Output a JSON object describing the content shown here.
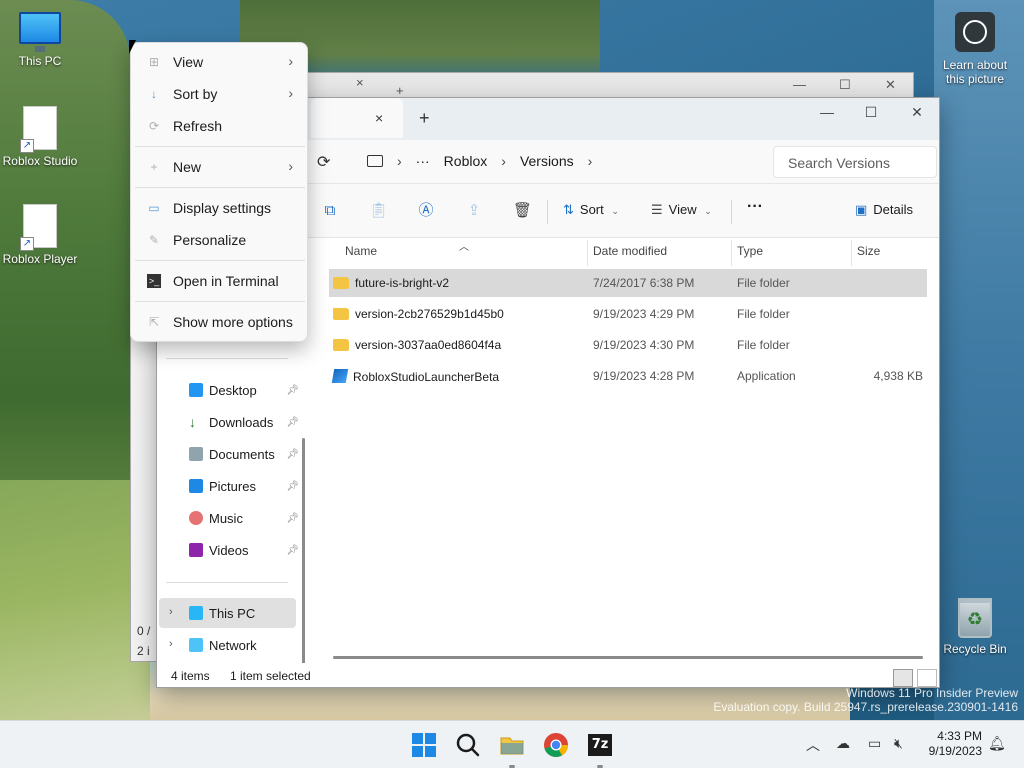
{
  "desktop": {
    "icons": [
      {
        "label": "This PC"
      },
      {
        "label": "Roblox Studio"
      },
      {
        "label": "Roblox Player"
      },
      {
        "label": "Recycle Bin"
      }
    ],
    "learn_label": "Learn about this picture"
  },
  "back_window": {
    "status_line1": "0 /",
    "status_line2": "2 i"
  },
  "explorer": {
    "tab_close": "×",
    "tab_new": "+",
    "controls": {
      "minimize": "—",
      "maximize": "☐",
      "close": "✕"
    },
    "breadcrumb": {
      "more": "···",
      "items": [
        "Roblox",
        "Versions"
      ]
    },
    "search_placeholder": "Search Versions",
    "commands": {
      "sort": "Sort",
      "view": "View",
      "more": "···",
      "details": "Details"
    },
    "nav": {
      "quick_access": [
        {
          "label": "Desktop",
          "icon": "desktop-icon",
          "color": "#2196f3"
        },
        {
          "label": "Downloads",
          "icon": "download-icon",
          "color": "#2e7d32"
        },
        {
          "label": "Documents",
          "icon": "document-icon",
          "color": "#78909c"
        },
        {
          "label": "Pictures",
          "icon": "picture-icon",
          "color": "#1e88e5"
        },
        {
          "label": "Music",
          "icon": "music-icon",
          "color": "#e57373"
        },
        {
          "label": "Videos",
          "icon": "video-icon",
          "color": "#8e24aa"
        }
      ],
      "this_pc": "This PC",
      "network": "Network"
    },
    "columns": [
      "Name",
      "Date modified",
      "Type",
      "Size"
    ],
    "files": [
      {
        "name": "future-is-bright-v2",
        "date": "7/24/2017 6:38 PM",
        "type": "File folder",
        "size": "",
        "kind": "folder",
        "selected": true
      },
      {
        "name": "version-2cb276529b1d45b0",
        "date": "9/19/2023 4:29 PM",
        "type": "File folder",
        "size": "",
        "kind": "folder",
        "selected": false
      },
      {
        "name": "version-3037aa0ed8604f4a",
        "date": "9/19/2023 4:30 PM",
        "type": "File folder",
        "size": "",
        "kind": "folder",
        "selected": false
      },
      {
        "name": "RobloxStudioLauncherBeta",
        "date": "9/19/2023 4:28 PM",
        "type": "Application",
        "size": "4,938 KB",
        "kind": "app",
        "selected": false
      }
    ],
    "status": {
      "count": "4 items",
      "selection": "1 item selected"
    }
  },
  "context_menu": {
    "items": [
      {
        "label": "View",
        "icon": "grid-icon",
        "submenu": true
      },
      {
        "label": "Sort by",
        "icon": "sort-icon",
        "submenu": true
      },
      {
        "label": "Refresh",
        "icon": "refresh-icon",
        "submenu": false
      },
      {
        "label": "New",
        "icon": "plus-icon",
        "submenu": true
      },
      {
        "label": "Display settings",
        "icon": "display-icon",
        "submenu": false
      },
      {
        "label": "Personalize",
        "icon": "brush-icon",
        "submenu": false
      },
      {
        "label": "Open in Terminal",
        "icon": "terminal-icon",
        "submenu": false
      },
      {
        "label": "Show more options",
        "icon": "external-icon",
        "submenu": false
      }
    ]
  },
  "watermark": {
    "line1": "Windows 11 Pro Insider Preview",
    "line2": "Evaluation copy. Build 25947.rs_prerelease.230901-1416"
  },
  "taskbar": {
    "time": "4:33 PM",
    "date": "9/19/2023",
    "sevenzip_label": "7z"
  }
}
